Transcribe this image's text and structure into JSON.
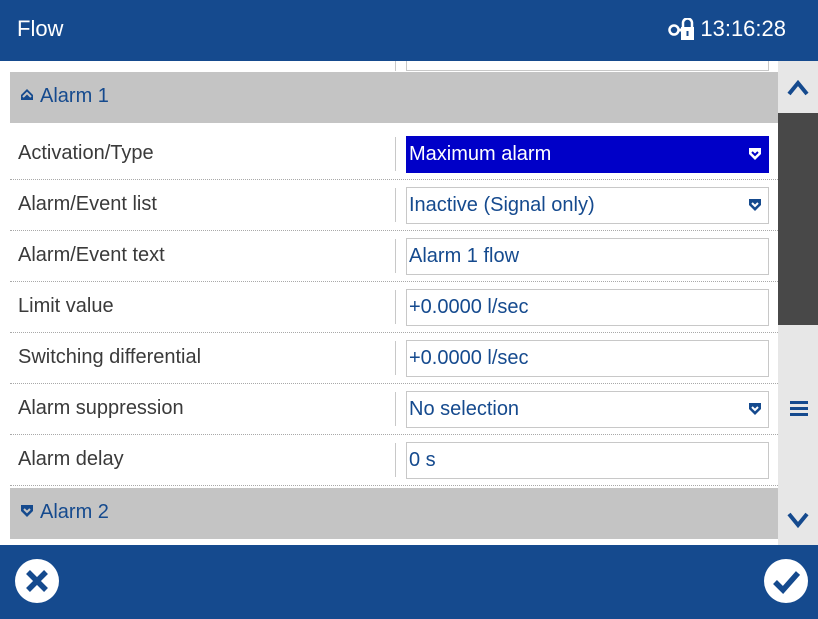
{
  "header": {
    "title": "Flow",
    "time": "13:16:28",
    "lock_icon": "lock-icon"
  },
  "sections": [
    {
      "label": "Alarm 1",
      "state": "expanded",
      "icon": "collapse-up-icon"
    },
    {
      "label": "Alarm 2",
      "state": "collapsed",
      "icon": "expand-down-icon"
    }
  ],
  "rows": [
    {
      "label": "Activation/Type",
      "value": "Maximum alarm",
      "kind": "dropdown",
      "selected": true
    },
    {
      "label": "Alarm/Event list",
      "value": "Inactive (Signal only)",
      "kind": "dropdown",
      "selected": false
    },
    {
      "label": "Alarm/Event text",
      "value": "Alarm 1 flow",
      "kind": "text"
    },
    {
      "label": "Limit value",
      "value": "+0.0000 l/sec",
      "kind": "text"
    },
    {
      "label": "Switching differential",
      "value": "+0.0000 l/sec",
      "kind": "text"
    },
    {
      "label": "Alarm suppression",
      "value": "No selection",
      "kind": "dropdown",
      "selected": false
    },
    {
      "label": "Alarm delay",
      "value": "0 s",
      "kind": "text"
    }
  ],
  "footer": {
    "cancel_icon": "cancel-icon",
    "ok_icon": "confirm-icon"
  },
  "scrollbar": {
    "up_icon": "chevron-up-icon",
    "menu_icon": "menu-icon",
    "down_icon": "chevron-down-icon"
  },
  "colors": {
    "header_bg": "#154a8e",
    "selected_bg": "#0000c8",
    "section_bg": "#c4c4c4",
    "value_text": "#154a8e"
  }
}
